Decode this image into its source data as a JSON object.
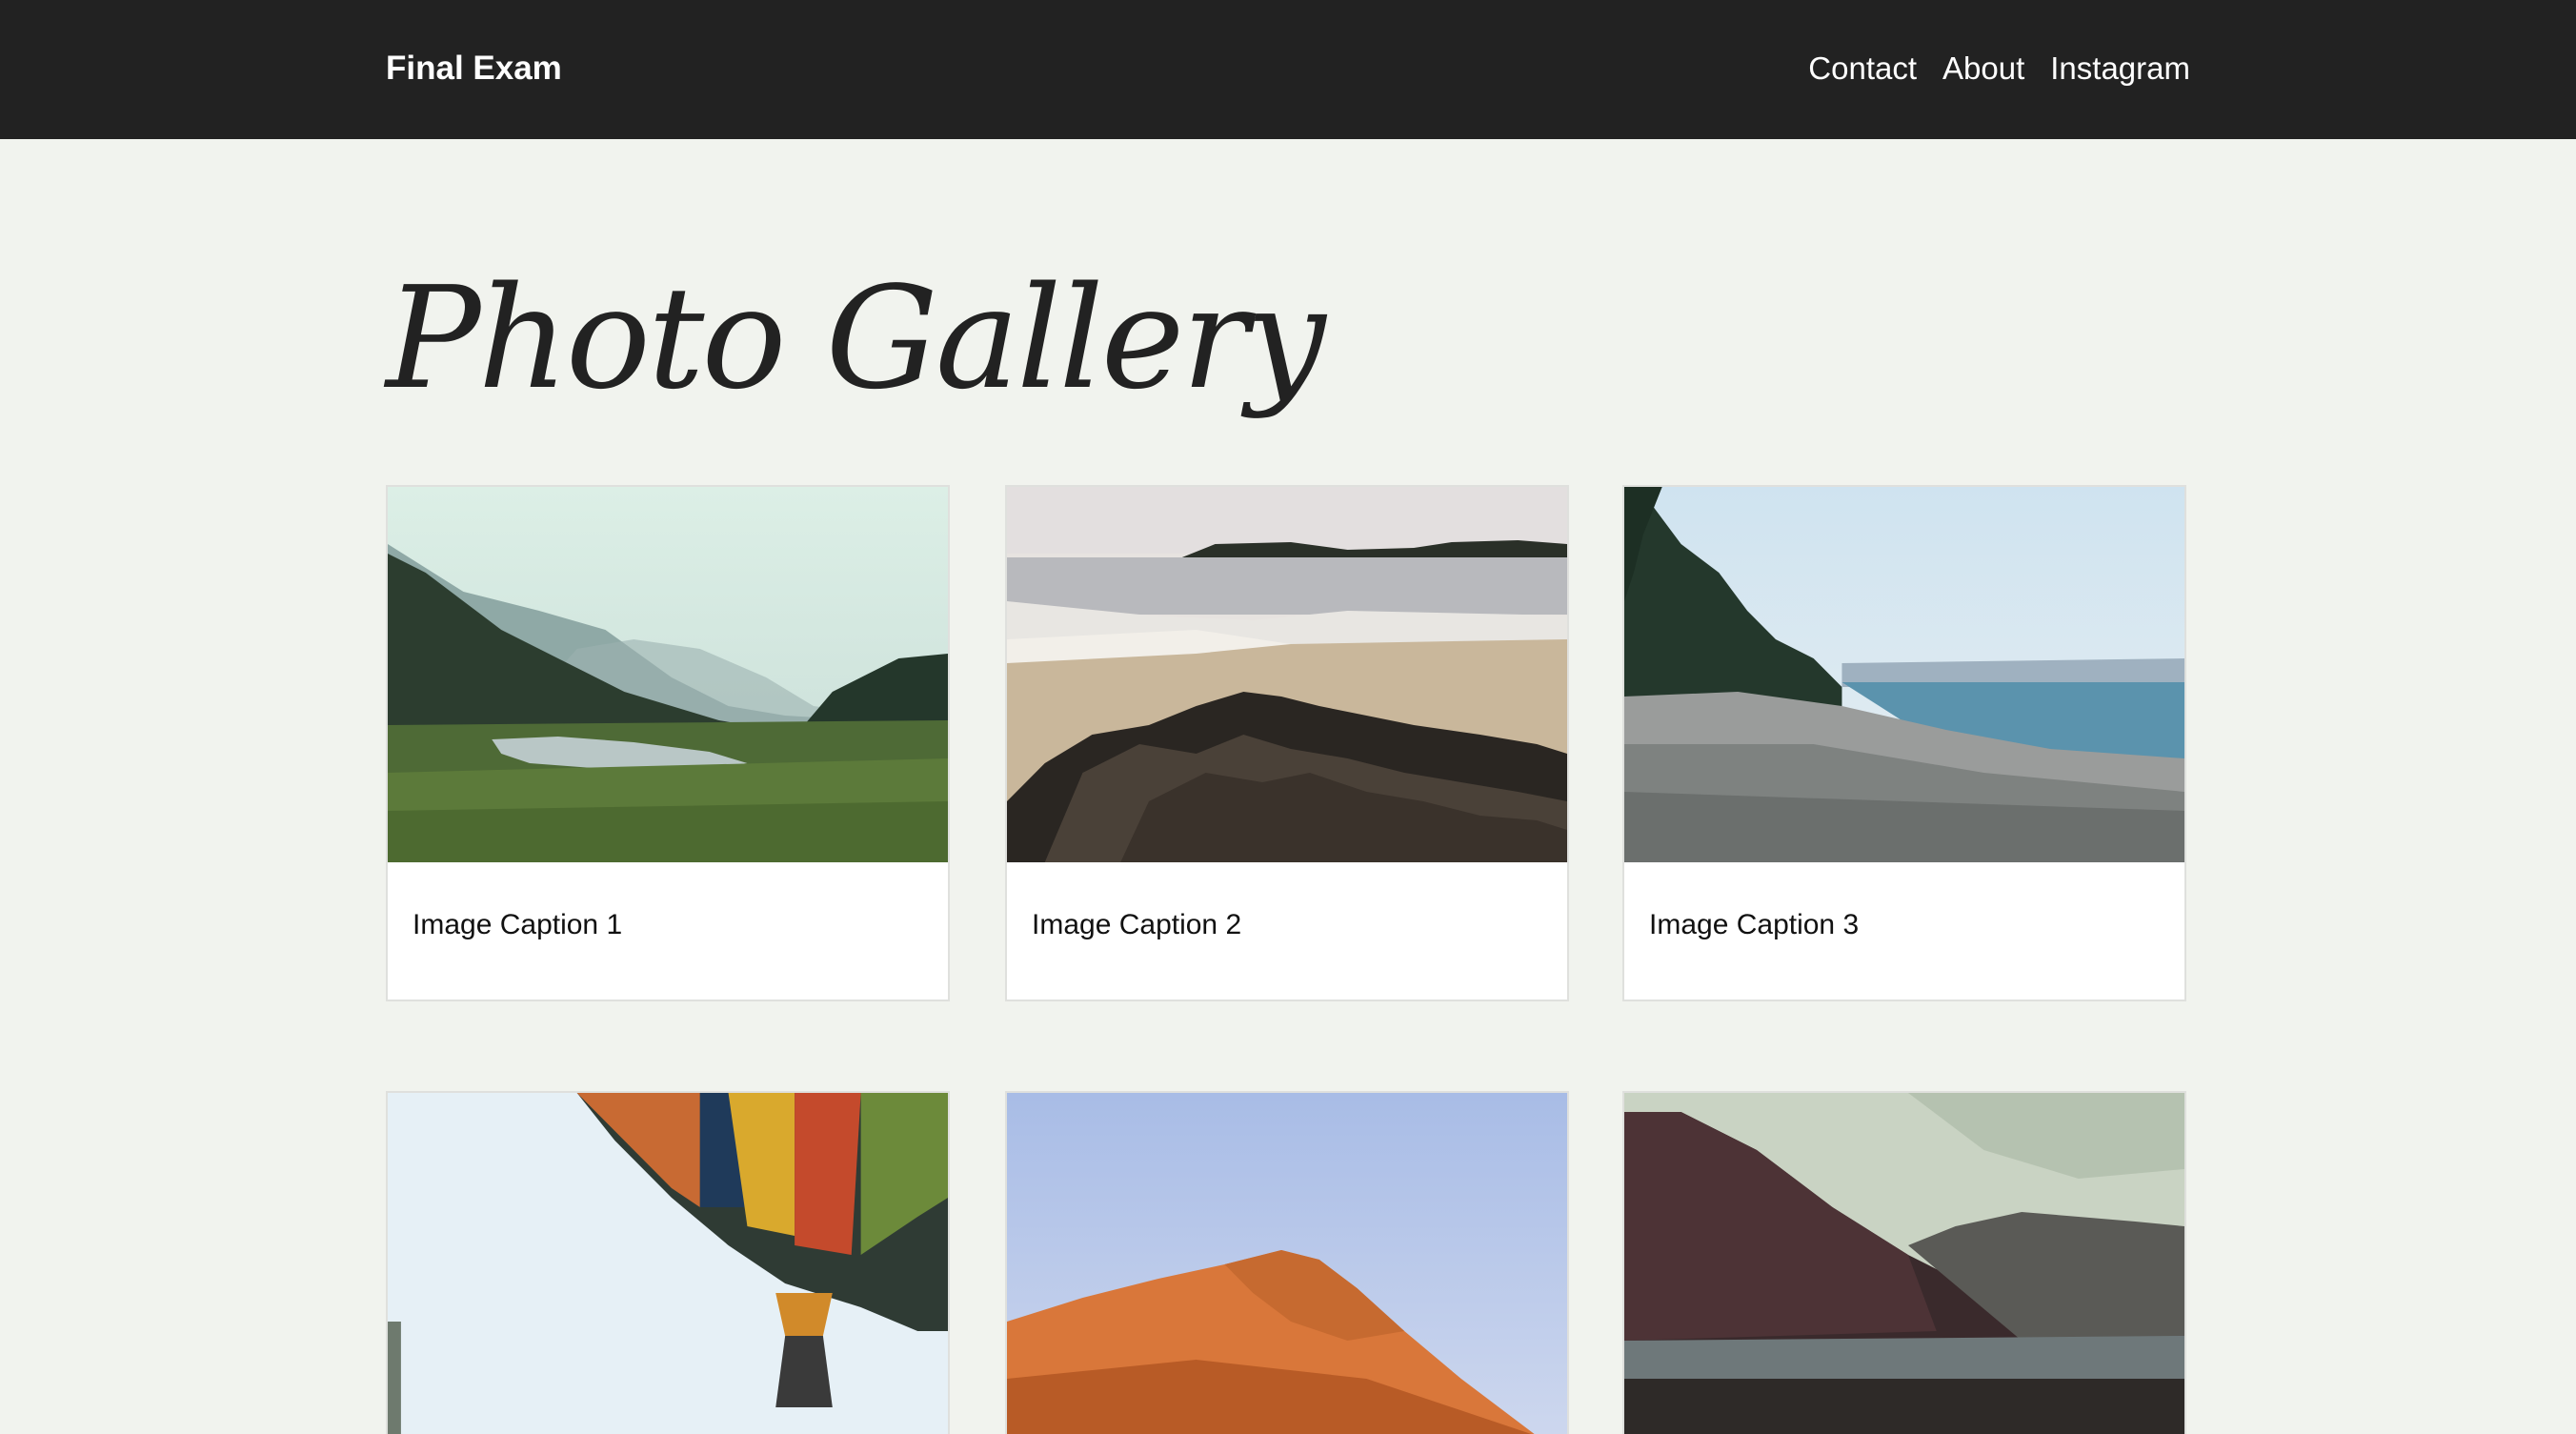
{
  "navbar": {
    "brand": "Final Exam",
    "links": [
      {
        "label": "Contact"
      },
      {
        "label": "About"
      },
      {
        "label": "Instagram"
      }
    ]
  },
  "main": {
    "title": "Photo Gallery",
    "gallery": [
      {
        "caption": "Image Caption 1",
        "scene": "forest-river-valley"
      },
      {
        "caption": "Image Caption 2",
        "scene": "rocky-beach-islands"
      },
      {
        "caption": "Image Caption 3",
        "scene": "pebble-shore-pines"
      },
      {
        "caption": "",
        "scene": "hot-air-balloon"
      },
      {
        "caption": "",
        "scene": "orange-sand-dune"
      },
      {
        "caption": "",
        "scene": "dark-mountains-lake"
      }
    ]
  },
  "colors": {
    "navbar_bg": "#222222",
    "page_bg": "#f1f3ee",
    "card_bg": "#ffffff",
    "text": "#222222"
  }
}
